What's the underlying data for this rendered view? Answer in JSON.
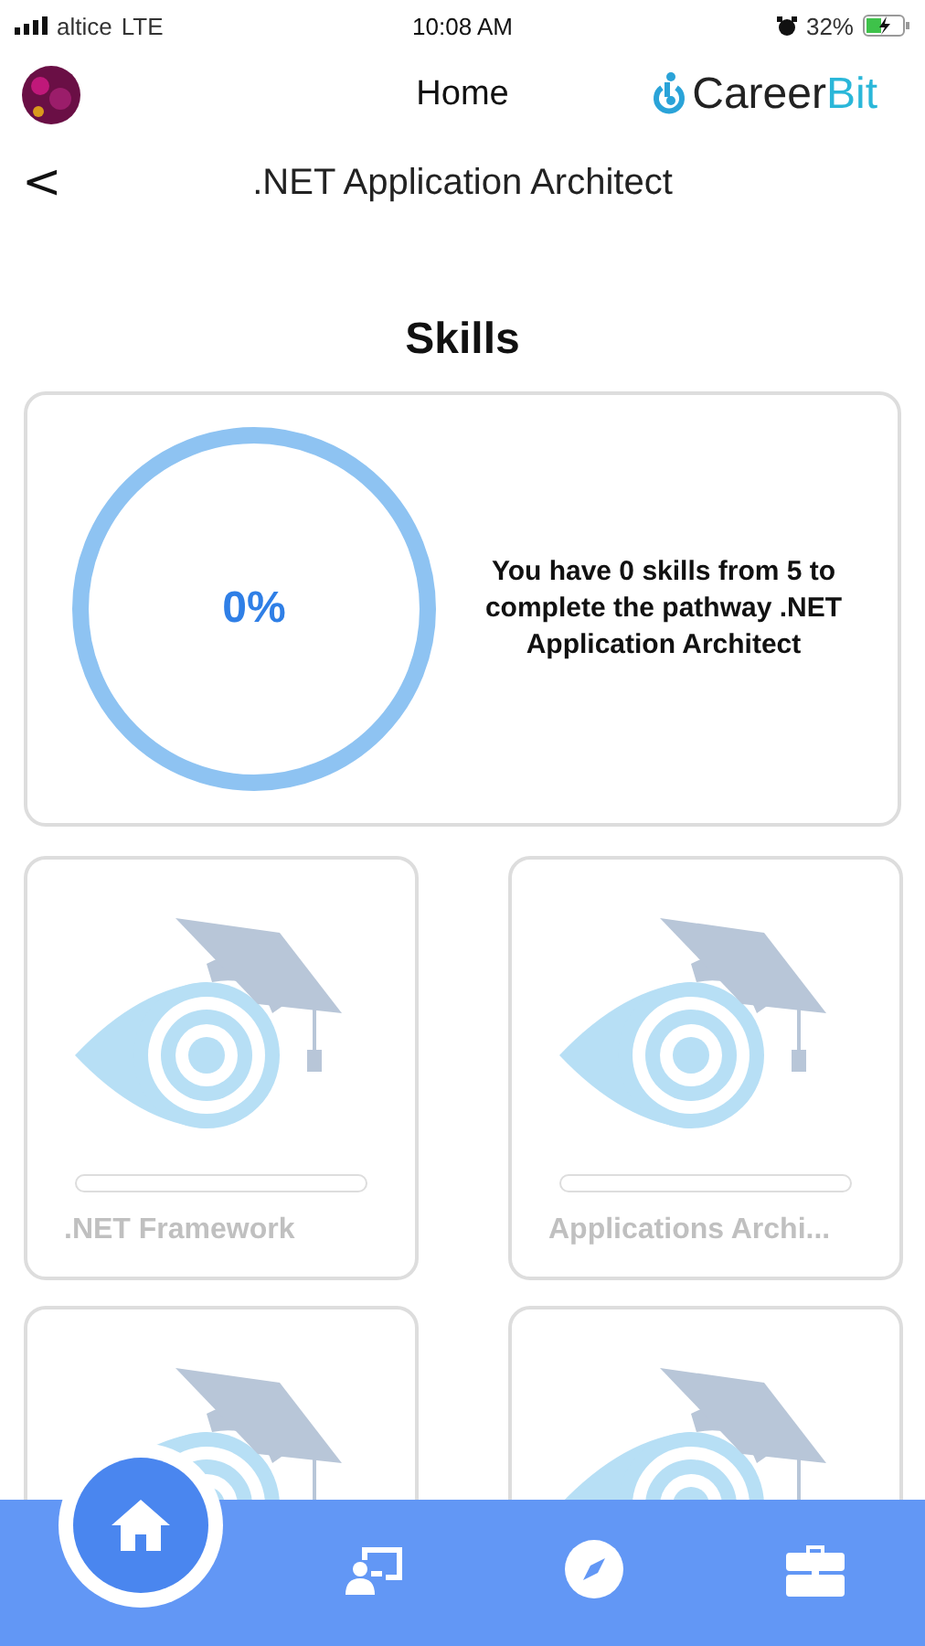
{
  "status_bar": {
    "carrier": "altice",
    "network": "LTE",
    "time": "10:08 AM",
    "battery": "32%"
  },
  "header": {
    "title": "Home",
    "logo_parts": [
      "Career",
      "Bit"
    ]
  },
  "subheader": {
    "back": "<",
    "title": ".NET Application Architect"
  },
  "section_title": "Skills",
  "summary": {
    "level": 0,
    "percent": "0%",
    "text": "You have 0 skills from 5 to complete the pathway .NET Application Architect"
  },
  "skills": [
    {
      "kind": "full",
      "name": ".NET Framework",
      "level": 0
    },
    {
      "kind": "full",
      "name": "Applications Archi...",
      "level": 0
    },
    {
      "kind": "partial"
    },
    {
      "kind": "partial"
    }
  ],
  "nav": [
    {
      "kind": "home",
      "selected": true
    },
    {
      "kind": "teacher",
      "selected": false
    },
    {
      "kind": "compass",
      "selected": false
    },
    {
      "kind": "briefcase",
      "selected": false
    }
  ]
}
